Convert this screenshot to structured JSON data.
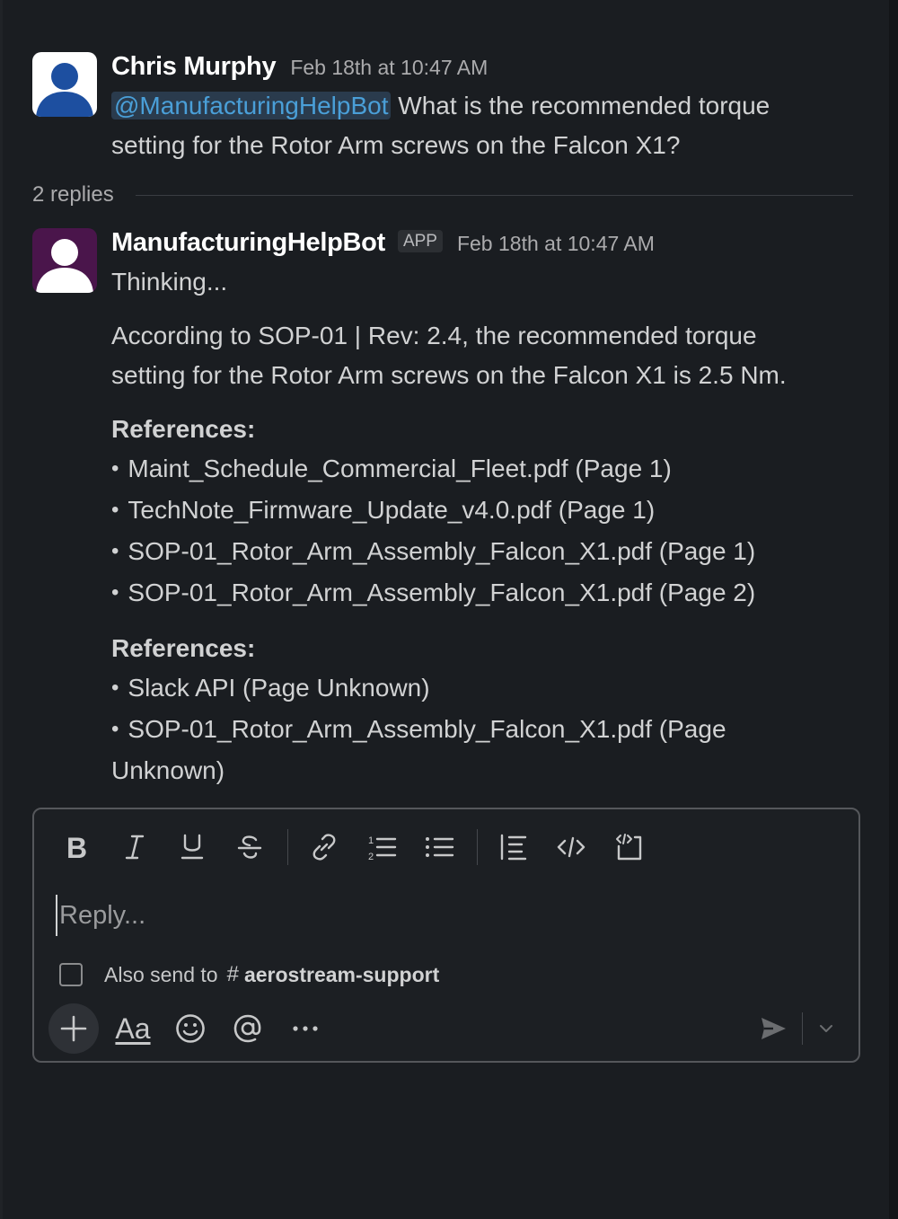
{
  "thread": {
    "parent": {
      "author": "Chris Murphy",
      "timestamp": "Feb 18th at 10:47 AM",
      "mention": "@ManufacturingHelpBot",
      "text_line1": " What is the recommended torque",
      "text_line2": "setting for the Rotor Arm screws on the Falcon X1?"
    },
    "replies_label": "2 replies",
    "bot_reply": {
      "author": "ManufacturingHelpBot",
      "badge": "APP",
      "timestamp": "Feb 18th at 10:47 AM",
      "thinking": "Thinking...",
      "answer_line1": "According to SOP-01 | Rev: 2.4, the recommended torque",
      "answer_line2": "setting for the Rotor Arm screws on the Falcon X1 is 2.5 Nm.",
      "references_heading_1": "References:",
      "references_1": [
        "Maint_Schedule_Commercial_Fleet.pdf (Page 1)",
        "TechNote_Firmware_Update_v4.0.pdf (Page 1)",
        "SOP-01_Rotor_Arm_Assembly_Falcon_X1.pdf (Page 1)",
        "SOP-01_Rotor_Arm_Assembly_Falcon_X1.pdf (Page 2)"
      ],
      "references_heading_2": "References:",
      "references_2": [
        "Slack API (Page Unknown)",
        "SOP-01_Rotor_Arm_Assembly_Falcon_X1.pdf (Page",
        "Unknown)"
      ]
    }
  },
  "composer": {
    "placeholder": "Reply...",
    "value": "",
    "also_send_label": "Also send to",
    "channel_hash": "#",
    "channel_name": "aerostream-support",
    "also_send_checked": false,
    "format_button_label": "Aa",
    "toolbar_icons": [
      "bold-icon",
      "italic-icon",
      "underline-icon",
      "strikethrough-icon",
      "link-icon",
      "ordered-list-icon",
      "bulleted-list-icon",
      "blockquote-icon",
      "code-icon",
      "code-block-icon"
    ],
    "bottom_icons": [
      "plus-icon",
      "text-format-icon",
      "emoji-icon",
      "mention-icon",
      "more-icon",
      "send-icon",
      "chevron-down-icon"
    ]
  },
  "colors": {
    "background": "#1a1d21",
    "mention_text": "#4a9fd8",
    "mention_bg": "#2a3b4d",
    "user_avatar_bg": "#ffffff",
    "user_avatar_fg": "#1d4fa0",
    "bot_avatar_bg": "#4a154b",
    "bot_avatar_fg": "#ffffff"
  }
}
